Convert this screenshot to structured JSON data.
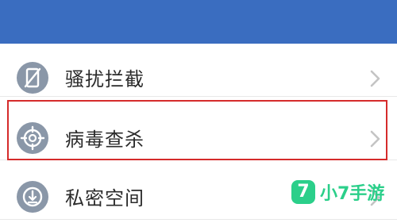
{
  "menu": {
    "items": [
      {
        "label": "骚扰拦截",
        "icon": "phone-block-icon"
      },
      {
        "label": "病毒查杀",
        "icon": "crosshair-shield-icon",
        "highlighted": true
      },
      {
        "label": "私密空间",
        "icon": "private-space-icon"
      }
    ]
  },
  "watermark": {
    "badge": "7",
    "text": "小7手游"
  },
  "colors": {
    "header": "#3a6dc0",
    "icon_gray": "#8a97a8",
    "highlight_border": "#d52b2b",
    "watermark_green": "#2bcf8a"
  }
}
